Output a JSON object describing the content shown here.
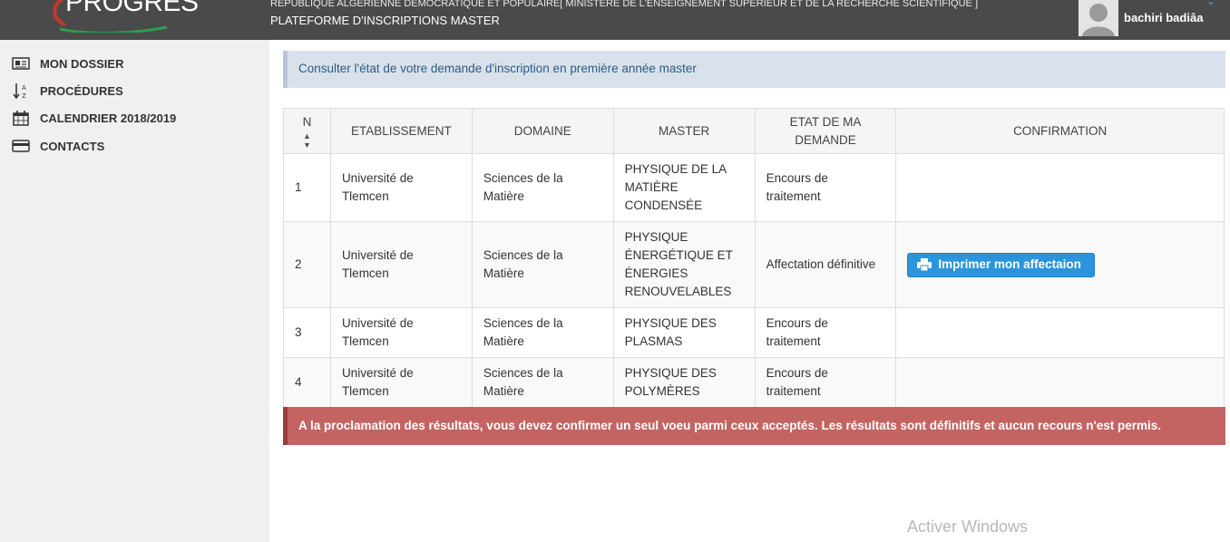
{
  "header": {
    "logo_text": "PROGRES",
    "line1": "REPUBLIQUE ALGERIENNE DEMOCRATIQUE ET POPULAIRE[ MINISTERE DE L'ENSEIGNEMENT SUPERIEUR ET DE LA RECHERCHE SCIENTIFIQUE ]",
    "line2": "PLATEFORME D'INSCRIPTIONS MASTER",
    "user_name": "bachiri badiâa",
    "caret_icon": "chevron-down-icon"
  },
  "sidebar": {
    "items": [
      {
        "label": "MON DOSSIER",
        "icon": "newspaper-icon"
      },
      {
        "label": "PROCÉDURES",
        "icon": "sort-alpha-icon"
      },
      {
        "label": "CALENDRIER 2018/2019",
        "icon": "calendar-icon"
      },
      {
        "label": "CONTACTS",
        "icon": "credit-card-icon"
      }
    ]
  },
  "main": {
    "info_text": "Consulter l'état de votre demande d'inscription en première année master",
    "table": {
      "headers": [
        "N",
        "ETABLISSEMENT",
        "DOMAINE",
        "MASTER",
        "ETAT DE MA DEMANDE",
        "CONFIRMATION"
      ],
      "rows": [
        {
          "n": "1",
          "etablissement": "Université de Tlemcen",
          "domaine": "Sciences de la Matière",
          "master": "PHYSIQUE DE LA MATIÈRE CONDENSÉE",
          "etat": "Encours de traitement",
          "confirmation": ""
        },
        {
          "n": "2",
          "etablissement": "Université de Tlemcen",
          "domaine": "Sciences de la Matière",
          "master": "PHYSIQUE ÉNERGÉTIQUE ET ÉNERGIES RENOUVELABLES",
          "etat": "Affectation définitive",
          "confirmation": "Imprimer mon affectaion"
        },
        {
          "n": "3",
          "etablissement": "Université de Tlemcen",
          "domaine": "Sciences de la Matière",
          "master": "PHYSIQUE DES PLASMAS",
          "etat": "Encours de traitement",
          "confirmation": ""
        },
        {
          "n": "4",
          "etablissement": "Université de Tlemcen",
          "domaine": "Sciences de la Matière",
          "master": "PHYSIQUE DES POLYMÈRES",
          "etat": "Encours de traitement",
          "confirmation": ""
        }
      ]
    },
    "alert_text": "A la proclamation des résultats, vous devez confirmer un seul voeu parmi ceux acceptés. Les résultats sont définitifs et aucun recours n'est permis.",
    "colors": {
      "accent": "#2a95dc",
      "danger": "#c36462",
      "info_bg": "#d9e2ec",
      "topbar": "#4a4a4a"
    }
  },
  "watermark": "Activer Windows"
}
